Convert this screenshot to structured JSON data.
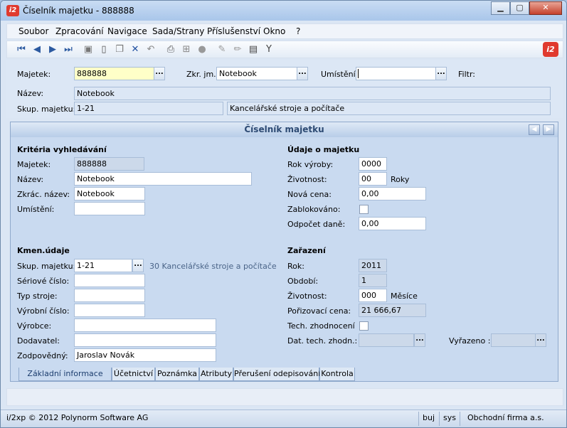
{
  "window": {
    "title": "Číselník majetku - 888888",
    "logo": "i2"
  },
  "menu": [
    "Soubor",
    "Zpracování",
    "Navigace",
    "Sada/Strany",
    "Příslušenství",
    "Okno",
    "?"
  ],
  "toolbar": {
    "icons": [
      "first-record-icon",
      "prev-record-icon",
      "next-record-icon",
      "last-record-icon",
      "save-icon",
      "new-icon",
      "copy-icon",
      "delete-icon",
      "undo-icon",
      "print-icon",
      "tree-icon",
      "disc-icon",
      "edit-icon",
      "pencil-icon",
      "export-icon",
      "filter-icon"
    ]
  },
  "header": {
    "majetek_label": "Majetek:",
    "majetek_value": "888888",
    "zkr_label": "Zkr. jm.:",
    "zkr_value": "Notebook",
    "umisteni_label": "Umístění:",
    "umisteni_value": "",
    "filtr_label": "Filtr:",
    "nazev_label": "Název:",
    "nazev_value": "Notebook",
    "skup_label": "Skup. majetku:",
    "skup_value": "1-21",
    "skup_desc": "Kancelářské stroje a počítače",
    "dots": "..."
  },
  "panel": {
    "title": "Číselník majetku",
    "criteria": {
      "title": "Kritéria vyhledávání",
      "majetek_label": "Majetek:",
      "majetek_value": "888888",
      "nazev_label": "Název:",
      "nazev_value": "Notebook",
      "zkrac_label": "Zkrác. název:",
      "zkrac_value": "Notebook",
      "umisteni_label": "Umístění:",
      "umisteni_value": ""
    },
    "kmen": {
      "title": "Kmen.údaje",
      "skup_label": "Skup. majetku:",
      "skup_value": "1-21",
      "skup_hint": "30  Kancelářské stroje a počítače",
      "seriove_label": "Sériové číslo:",
      "seriove_value": "",
      "typ_label": "Typ stroje:",
      "typ_value": "",
      "vyrobni_label": "Výrobní číslo:",
      "vyrobni_value": "",
      "vyrobce_label": "Výrobce:",
      "vyrobce_value": "",
      "dodavatel_label": "Dodavatel:",
      "dodavatel_value": "",
      "zodpovedny_label": "Zodpovědný:",
      "zodpovedny_value": "Jaroslav Novák"
    },
    "udaje": {
      "title": "Údaje o majetku",
      "rok_label": "Rok výroby:",
      "rok_value": "0000",
      "zivotnost_label": "Životnost:",
      "zivotnost_value": "00",
      "zivotnost_unit": "Roky",
      "cena_label": "Nová cena:",
      "cena_value": "0,00",
      "zablok_label": "Zablokováno:",
      "odpocet_label": "Odpočet daně:",
      "odpocet_value": "0,00"
    },
    "zarazeni": {
      "title": "Zařazení",
      "rok_label": "Rok:",
      "rok_value": "2011",
      "obdobi_label": "Období:",
      "obdobi_value": "1",
      "zivotnost_label": "Životnost:",
      "zivotnost_value": "000",
      "zivotnost_unit": "Měsíce",
      "porizovaci_label": "Pořizovací cena:",
      "porizovaci_value": "21 666,67",
      "tech_label": "Tech. zhodnocení",
      "dat_label": "Dat. tech. zhodn.:",
      "vyrazeno_label": "Vyřazeno  :"
    }
  },
  "tabs": [
    "Základní informace",
    "Účetnictví",
    "Poznámka",
    "Atributy",
    "Přerušení odepisování",
    "Kontrola"
  ],
  "status": {
    "copyright": "i/2xp © 2012 Polynorm Software AG",
    "lang": "buj",
    "user": "sys",
    "company": "Obchodní firma a.s."
  },
  "colors": {
    "accent": "#e03a2e",
    "panel": "#c9daf0",
    "highlight": "#ffffc8"
  }
}
